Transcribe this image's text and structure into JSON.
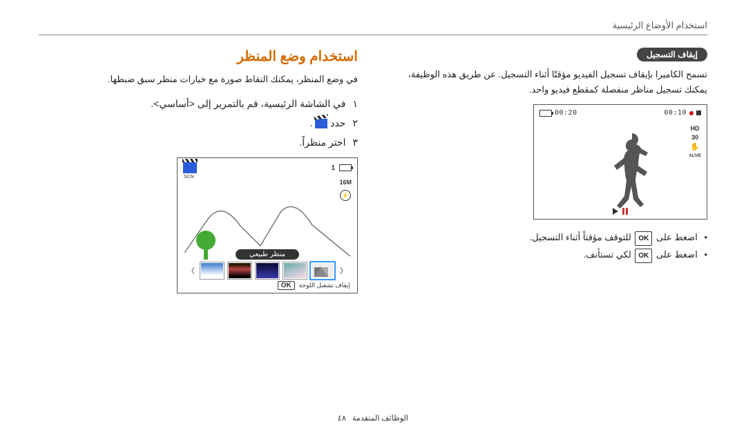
{
  "header": {
    "breadcrumb": "استخدام الأوضاع الرئيسية"
  },
  "pause_section": {
    "pill": "إيقاف التسجيل",
    "para": "تسمح الكاميرا بإيقاف تسجيل الفيديو مؤقتًا أثناء التسجيل. عن طريق هذه الوظيفة، يمكنك تسجيل مناظر منفصلة كمقطع فيديو واحد.",
    "time_elapsed": "00:10",
    "time_total": "00:20",
    "side_icons": {
      "hd": "HD",
      "fps": "30",
      "alive": "ALIVE"
    },
    "bullet1_pre": "اضغط على",
    "bullet1_post": "للتوقف مؤقتاً أثناء التسجيل.",
    "bullet2_pre": "اضغط على",
    "bullet2_post": "لكي تستأنف.",
    "ok": "OK"
  },
  "scene_section": {
    "title": "استخدام وضع المنظر",
    "intro": "في وضع المنظر، يمكنك التقاط صورة مع خيارات منظر سبق ضبطها.",
    "steps": {
      "s1_num": "١",
      "s1": "في الشاشة الرئيسية، قم بالتمرير إلى <أساسي>.",
      "s2_num": "٢",
      "s2_pre": "حدد",
      "s2_post": ".",
      "s3_num": "٣",
      "s3": "اختر منظراً."
    },
    "preview": {
      "scn_label": "SCN",
      "counter": "1",
      "res": "16M",
      "pill": "منظر طبيعي",
      "menu_hint": "إيقاف تشغيل اللوحة",
      "ok": "OK"
    }
  },
  "footer": {
    "section": "الوظائف المتقدمة",
    "page": "٤٨"
  }
}
